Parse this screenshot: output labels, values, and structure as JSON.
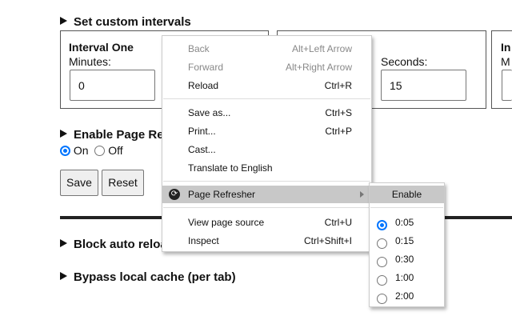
{
  "sections": {
    "custom_intervals": "Set custom intervals",
    "enable": "Enable Page Refresher",
    "block": "Block auto reload",
    "bypass": "Bypass local cache (per tab)"
  },
  "intervals": [
    {
      "title": "Interval One",
      "minutes_label": "Minutes:",
      "minutes": "0"
    },
    {
      "seconds_label": "Seconds:",
      "seconds": "15"
    },
    {
      "title": "In",
      "minutes_label": "M"
    }
  ],
  "enable_options": {
    "on": "On",
    "off": "Off",
    "selected": "On"
  },
  "buttons": {
    "save": "Save",
    "reset": "Reset"
  },
  "context_menu": [
    {
      "label": "Back",
      "shortcut": "Alt+Left Arrow",
      "disabled": true
    },
    {
      "label": "Forward",
      "shortcut": "Alt+Right Arrow",
      "disabled": true
    },
    {
      "label": "Reload",
      "shortcut": "Ctrl+R"
    },
    {
      "label": "Save as...",
      "shortcut": "Ctrl+S"
    },
    {
      "label": "Print...",
      "shortcut": "Ctrl+P"
    },
    {
      "label": "Cast...",
      "shortcut": ""
    },
    {
      "label": "Translate to English",
      "shortcut": ""
    },
    {
      "label": "Page Refresher",
      "shortcut": ""
    },
    {
      "label": "View page source",
      "shortcut": "Ctrl+U"
    },
    {
      "label": "Inspect",
      "shortcut": "Ctrl+Shift+I"
    }
  ],
  "submenu": {
    "enable": "Enable",
    "options": [
      "0:05",
      "0:15",
      "0:30",
      "1:00",
      "2:00"
    ],
    "selected": "0:05"
  },
  "colors": {
    "accent": "#0075ff",
    "highlight": "#c8c8c8"
  }
}
